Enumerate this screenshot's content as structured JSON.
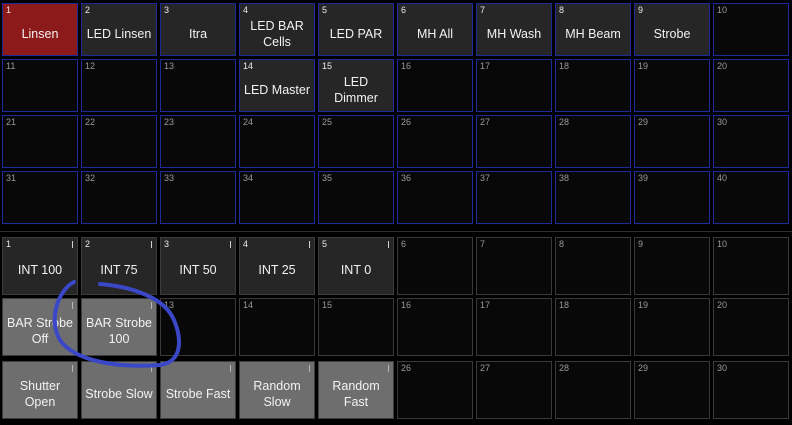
{
  "top_grid": {
    "cells": [
      {
        "n": "1",
        "label": "Linsen",
        "style": "red"
      },
      {
        "n": "2",
        "label": "LED Linsen",
        "style": "filled"
      },
      {
        "n": "3",
        "label": "Itra",
        "style": "filled"
      },
      {
        "n": "4",
        "label": "LED BAR\nCells",
        "style": "filled"
      },
      {
        "n": "5",
        "label": "LED PAR",
        "style": "filled"
      },
      {
        "n": "6",
        "label": "MH All",
        "style": "filled"
      },
      {
        "n": "7",
        "label": "MH Wash",
        "style": "filled"
      },
      {
        "n": "8",
        "label": "MH Beam",
        "style": "filled"
      },
      {
        "n": "9",
        "label": "Strobe",
        "style": "filled"
      },
      {
        "n": "10",
        "label": "",
        "style": "empty"
      },
      {
        "n": "11",
        "label": "",
        "style": "empty"
      },
      {
        "n": "12",
        "label": "",
        "style": "empty"
      },
      {
        "n": "13",
        "label": "",
        "style": "empty"
      },
      {
        "n": "14",
        "label": "LED Master",
        "style": "filled"
      },
      {
        "n": "15",
        "label": "LED Dimmer",
        "style": "filled"
      },
      {
        "n": "16",
        "label": "",
        "style": "empty"
      },
      {
        "n": "17",
        "label": "",
        "style": "empty"
      },
      {
        "n": "18",
        "label": "",
        "style": "empty"
      },
      {
        "n": "19",
        "label": "",
        "style": "empty"
      },
      {
        "n": "20",
        "label": "",
        "style": "empty"
      },
      {
        "n": "21",
        "label": "",
        "style": "empty"
      },
      {
        "n": "22",
        "label": "",
        "style": "empty"
      },
      {
        "n": "23",
        "label": "",
        "style": "empty"
      },
      {
        "n": "24",
        "label": "",
        "style": "empty"
      },
      {
        "n": "25",
        "label": "",
        "style": "empty"
      },
      {
        "n": "26",
        "label": "",
        "style": "empty"
      },
      {
        "n": "27",
        "label": "",
        "style": "empty"
      },
      {
        "n": "28",
        "label": "",
        "style": "empty"
      },
      {
        "n": "29",
        "label": "",
        "style": "empty"
      },
      {
        "n": "30",
        "label": "",
        "style": "empty"
      },
      {
        "n": "31",
        "label": "",
        "style": "empty"
      },
      {
        "n": "32",
        "label": "",
        "style": "empty"
      },
      {
        "n": "33",
        "label": "",
        "style": "empty"
      },
      {
        "n": "34",
        "label": "",
        "style": "empty"
      },
      {
        "n": "35",
        "label": "",
        "style": "empty"
      },
      {
        "n": "36",
        "label": "",
        "style": "empty"
      },
      {
        "n": "37",
        "label": "",
        "style": "empty"
      },
      {
        "n": "38",
        "label": "",
        "style": "empty"
      },
      {
        "n": "39",
        "label": "",
        "style": "empty"
      },
      {
        "n": "40",
        "label": "",
        "style": "empty"
      }
    ]
  },
  "bottom_grid": {
    "cells": [
      {
        "n": "1",
        "label": "INT 100",
        "style": "filled",
        "flag": true
      },
      {
        "n": "2",
        "label": "INT 75",
        "style": "filled",
        "flag": true
      },
      {
        "n": "3",
        "label": "INT 50",
        "style": "filled",
        "flag": true
      },
      {
        "n": "4",
        "label": "INT 25",
        "style": "filled",
        "flag": true
      },
      {
        "n": "5",
        "label": "INT 0",
        "style": "filled",
        "flag": true
      },
      {
        "n": "6",
        "label": "",
        "style": "empty"
      },
      {
        "n": "7",
        "label": "",
        "style": "empty"
      },
      {
        "n": "8",
        "label": "",
        "style": "empty"
      },
      {
        "n": "9",
        "label": "",
        "style": "empty"
      },
      {
        "n": "10",
        "label": "",
        "style": "empty"
      },
      {
        "n": "",
        "label": "BAR Strobe\nOff",
        "style": "gray",
        "flag": true
      },
      {
        "n": "",
        "label": "BAR Strobe\n100",
        "style": "gray",
        "flag": true
      },
      {
        "n": "13",
        "label": "",
        "style": "empty"
      },
      {
        "n": "14",
        "label": "",
        "style": "empty"
      },
      {
        "n": "15",
        "label": "",
        "style": "empty"
      },
      {
        "n": "16",
        "label": "",
        "style": "empty"
      },
      {
        "n": "17",
        "label": "",
        "style": "empty"
      },
      {
        "n": "18",
        "label": "",
        "style": "empty"
      },
      {
        "n": "19",
        "label": "",
        "style": "empty"
      },
      {
        "n": "20",
        "label": "",
        "style": "empty"
      },
      {
        "n": "",
        "label": "Shutter\nOpen",
        "style": "gray",
        "flag": true
      },
      {
        "n": "",
        "label": "Strobe Slow",
        "style": "gray",
        "flag": true
      },
      {
        "n": "",
        "label": "Strobe Fast",
        "style": "gray",
        "flag": true
      },
      {
        "n": "",
        "label": "Random\nSlow",
        "style": "gray",
        "flag": true
      },
      {
        "n": "",
        "label": "Random Fast",
        "style": "gray",
        "flag": true
      },
      {
        "n": "26",
        "label": "",
        "style": "empty"
      },
      {
        "n": "27",
        "label": "",
        "style": "empty"
      },
      {
        "n": "28",
        "label": "",
        "style": "empty"
      },
      {
        "n": "29",
        "label": "",
        "style": "empty"
      },
      {
        "n": "30",
        "label": "",
        "style": "empty"
      }
    ]
  },
  "annotation": {
    "color": "#3a48c8"
  }
}
